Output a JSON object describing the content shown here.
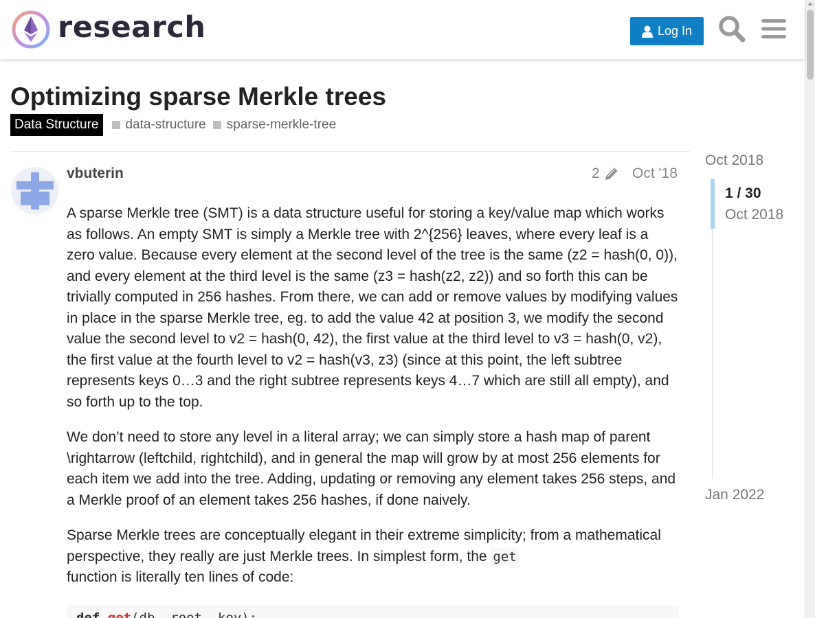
{
  "header": {
    "site_name": "research",
    "login_label": "Log In",
    "icons": [
      "logo-icon",
      "user-icon",
      "search-icon",
      "hamburger-menu-icon"
    ]
  },
  "topic": {
    "title": "Optimizing sparse Merkle trees",
    "category": "Data Structure",
    "tags": [
      "data-structure",
      "sparse-merkle-tree"
    ]
  },
  "post": {
    "username": "vbuterin",
    "edit_count": "2",
    "date": "Oct '18",
    "paragraphs": [
      "A sparse Merkle tree (SMT) is a data structure useful for storing a key/value map which works as follows. An empty SMT is simply a Merkle tree with 2^{256} leaves, where every leaf is a zero value. Because every element at the second level of the tree is the same (z2 = hash(0, 0)), and every element at the third level is the same (z3 = hash(z2, z2)) and so forth this can be trivially computed in 256 hashes. From there, we can add or remove values by modifying values in place in the sparse Merkle tree, eg. to add the value 42 at position 3, we modify the second value the second level to v2 = hash(0, 42), the first value at the third level to v3 = hash(0, v2), the first value at the fourth level to v2 = hash(v3, z3) (since at this point, the left subtree represents keys 0…3 and the right subtree represents keys 4…7 which are still all empty), and so forth up to the top.",
      "We don’t need to store any level in a literal array; we can simply store a hash map of parent \\rightarrow (leftchild, rightchild), and in general the map will grow by at most 256 elements for each item we add into the tree. Adding, updating or removing any element takes 256 steps, and a Merkle proof of an element takes 256 hashes, if done naively."
    ],
    "p3_before": "Sparse Merkle trees are conceptually elegant in their extreme simplicity; from a mathematical perspective, they really are just Merkle trees. In simplest form, the ",
    "p3_code": "get",
    "p3_after": " function is literally ten lines of code:",
    "code_kw": "def",
    "code_fn": "get",
    "code_rest": "(db, root, key):"
  },
  "timeline": {
    "start_label": "Oct 2018",
    "position": "1 / 30",
    "current_date": "Oct 2018",
    "end_label": "Jan 2022",
    "progress_fraction": 0.033
  },
  "colors": {
    "accent": "#0f80c6",
    "category_bg": "#000000",
    "timeline_handle": "#aad5f2"
  }
}
